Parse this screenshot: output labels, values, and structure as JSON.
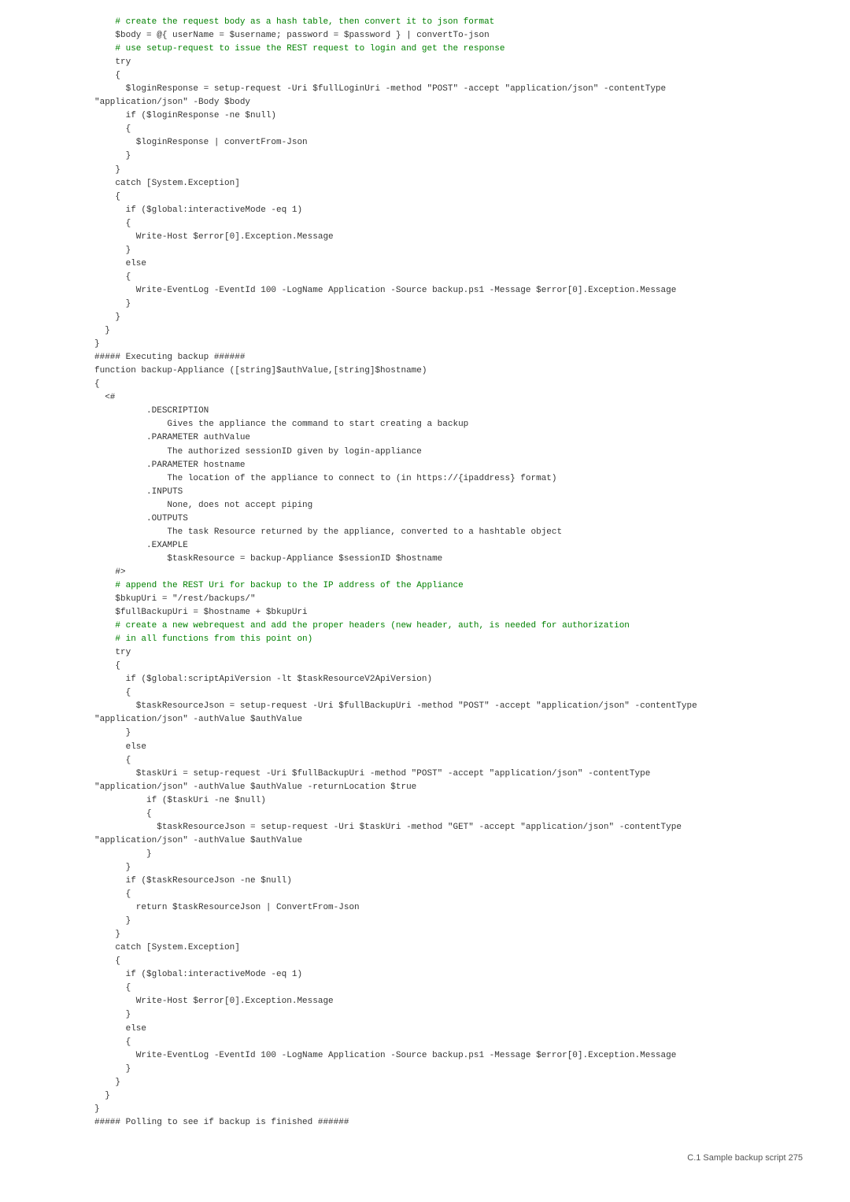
{
  "footer": {
    "text": "C.1  Sample backup script    275"
  },
  "code": {
    "lines": [
      "    # create the request body as a hash table, then convert it to json format",
      "    $body = @{ userName = $username; password = $password } | convertTo-json",
      "",
      "    # use setup-request to issue the REST request to login and get the response",
      "    try",
      "    {",
      "      $loginResponse = setup-request -Uri $fullLoginUri -method \"POST\" -accept \"application/json\" -contentType",
      "\"application/json\" -Body $body",
      "      if ($loginResponse -ne $null)",
      "      {",
      "        $loginResponse | convertFrom-Json",
      "      }",
      "    }",
      "    catch [System.Exception]",
      "    {",
      "      if ($global:interactiveMode -eq 1)",
      "      {",
      "        Write-Host $error[0].Exception.Message",
      "      }",
      "      else",
      "      {",
      "        Write-EventLog -EventId 100 -LogName Application -Source backup.ps1 -Message $error[0].Exception.Message",
      "",
      "      }",
      "    }",
      "  }",
      "}",
      "",
      "##### Executing backup ######",
      "function backup-Appliance ([string]$authValue,[string]$hostname)",
      "{",
      "  <#",
      "          .DESCRIPTION",
      "              Gives the appliance the command to start creating a backup",
      "",
      "          .PARAMETER authValue",
      "              The authorized sessionID given by login-appliance",
      "",
      "          .PARAMETER hostname",
      "              The location of the appliance to connect to (in https://{ipaddress} format)",
      "",
      "          .INPUTS",
      "              None, does not accept piping",
      "",
      "          .OUTPUTS",
      "              The task Resource returned by the appliance, converted to a hashtable object",
      "",
      "          .EXAMPLE",
      "              $taskResource = backup-Appliance $sessionID $hostname",
      "    #>",
      "",
      "    # append the REST Uri for backup to the IP address of the Appliance",
      "    $bkupUri = \"/rest/backups/\"",
      "    $fullBackupUri = $hostname + $bkupUri",
      "",
      "    # create a new webrequest and add the proper headers (new header, auth, is needed for authorization",
      "    # in all functions from this point on)",
      "    try",
      "    {",
      "      if ($global:scriptApiVersion -lt $taskResourceV2ApiVersion)",
      "      {",
      "        $taskResourceJson = setup-request -Uri $fullBackupUri -method \"POST\" -accept \"application/json\" -contentType",
      "\"application/json\" -authValue $authValue",
      "      }",
      "      else",
      "      {",
      "        $taskUri = setup-request -Uri $fullBackupUri -method \"POST\" -accept \"application/json\" -contentType",
      "\"application/json\" -authValue $authValue -returnLocation $true",
      "          if ($taskUri -ne $null)",
      "          {",
      "            $taskResourceJson = setup-request -Uri $taskUri -method \"GET\" -accept \"application/json\" -contentType",
      "\"application/json\" -authValue $authValue",
      "          }",
      "      }",
      "      if ($taskResourceJson -ne $null)",
      "      {",
      "        return $taskResourceJson | ConvertFrom-Json",
      "      }",
      "    }",
      "    catch [System.Exception]",
      "    {",
      "      if ($global:interactiveMode -eq 1)",
      "      {",
      "        Write-Host $error[0].Exception.Message",
      "      }",
      "      else",
      "      {",
      "        Write-EventLog -EventId 100 -LogName Application -Source backup.ps1 -Message $error[0].Exception.Message",
      "",
      "      }",
      "    }",
      "  }",
      "}",
      "",
      "##### Polling to see if backup is finished ######"
    ]
  }
}
